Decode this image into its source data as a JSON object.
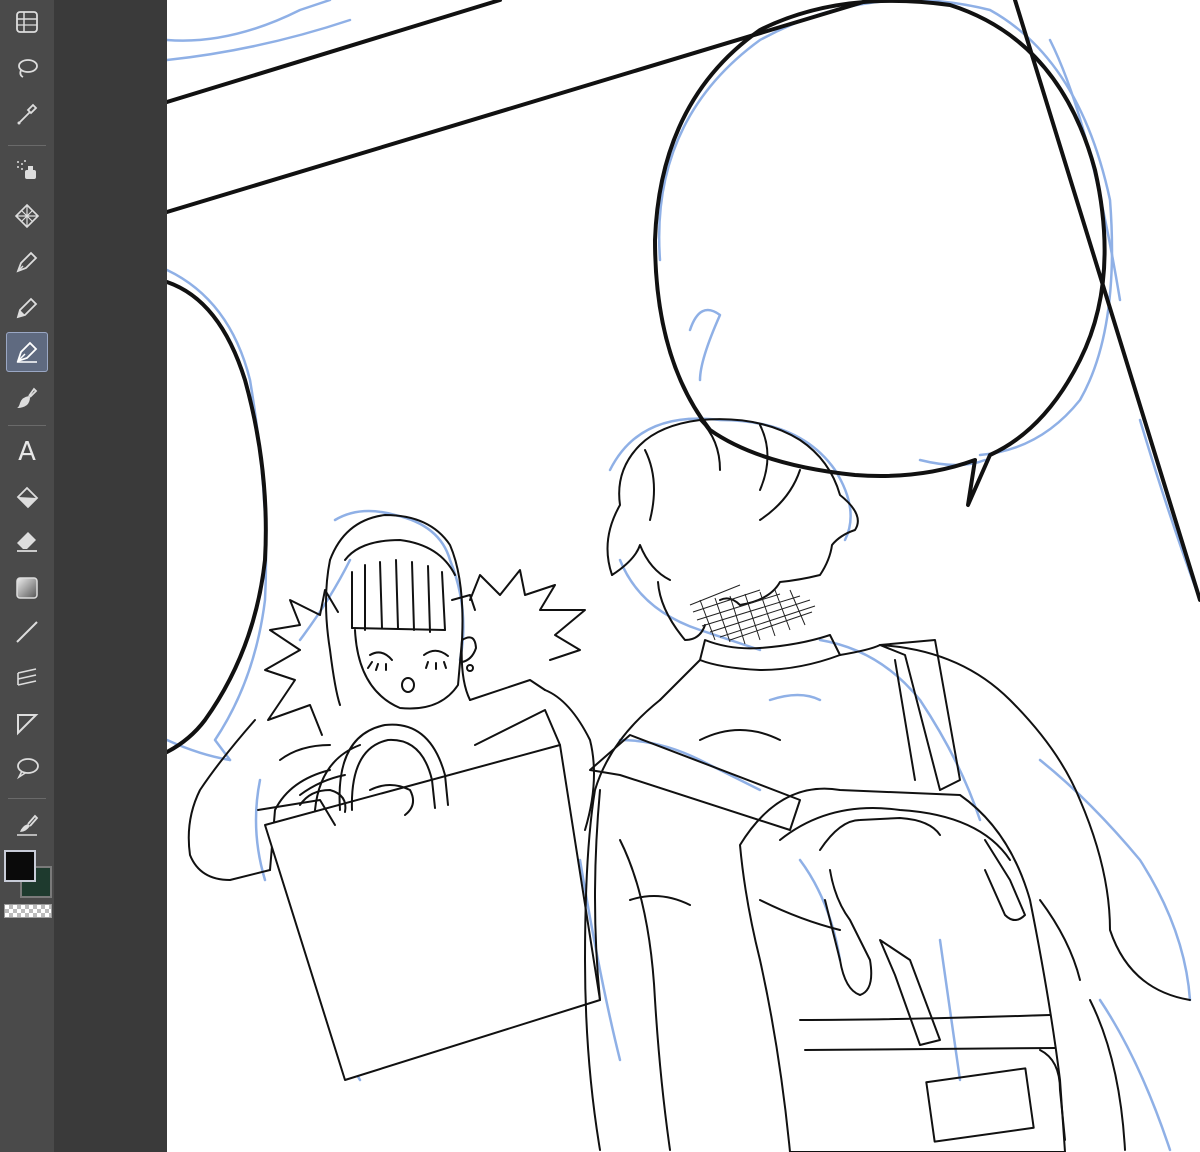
{
  "app": {
    "toolbar": {
      "tools": [
        {
          "name": "sub-view-icon",
          "active": false
        },
        {
          "name": "lasso-select-icon",
          "active": false
        },
        {
          "name": "eyedropper-icon",
          "active": false
        },
        {
          "name": "airbrush-icon",
          "active": false
        },
        {
          "name": "decoration-icon",
          "active": false
        },
        {
          "name": "pen-icon",
          "active": false
        },
        {
          "name": "pencil-icon",
          "active": false
        },
        {
          "name": "ink-pen-icon",
          "active": true
        },
        {
          "name": "brush-icon",
          "active": false
        },
        {
          "name": "text-tool-icon",
          "active": false
        },
        {
          "name": "fill-bucket-icon",
          "active": false
        },
        {
          "name": "eraser-icon",
          "active": false
        },
        {
          "name": "gradient-icon",
          "active": false
        },
        {
          "name": "line-tool-icon",
          "active": false
        },
        {
          "name": "ruler-icon",
          "active": false
        },
        {
          "name": "frame-border-icon",
          "active": false
        },
        {
          "name": "balloon-icon",
          "active": false
        },
        {
          "name": "correct-line-icon",
          "active": false
        }
      ],
      "text_tool_glyph": "A"
    },
    "colors": {
      "main": "#0a0a0a",
      "sub": "#1e3a2e",
      "toolbar_bg": "#4a4a4a",
      "panel_bg": "#3a3a3a",
      "active_tool_bg": "#5f6a80",
      "sketch_line": "#8fb0e6",
      "ink_line": "#111111"
    }
  }
}
